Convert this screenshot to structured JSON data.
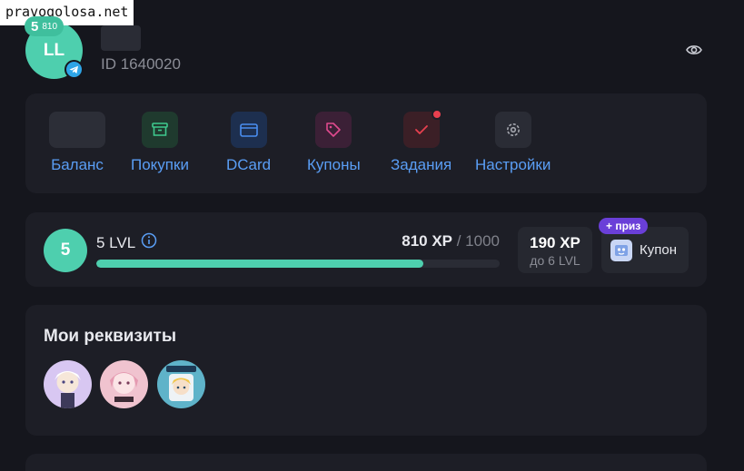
{
  "watermark": "pravogolosa.net",
  "profile": {
    "initials": "LL",
    "level": "5",
    "xp_badge": "810",
    "user_id": "ID 1640020"
  },
  "menu": {
    "items": [
      {
        "label": "Баланс",
        "icon": "balance-icon"
      },
      {
        "label": "Покупки",
        "icon": "archive-box-icon"
      },
      {
        "label": "DCard",
        "icon": "card-icon"
      },
      {
        "label": "Купоны",
        "icon": "tag-icon"
      },
      {
        "label": "Задания",
        "icon": "check-icon"
      },
      {
        "label": "Настройки",
        "icon": "gear-icon"
      }
    ]
  },
  "xp": {
    "level_number": "5",
    "level_label": "5 LVL",
    "current": "810 XP",
    "max": "/ 1000",
    "progress_fraction": 0.81,
    "next_xp": "190 XP",
    "next_level": "до 6 LVL",
    "prize_tag": "+ приз",
    "prize_label": "Купон"
  },
  "requisites": {
    "title": "Мои реквизиты"
  },
  "colors": {
    "accent_teal": "#4ecfae",
    "link_blue": "#5a9ef5",
    "prize_purple": "#6a3fd8",
    "notification_red": "#e8404f",
    "background": "#15161d",
    "card": "#1d1e26"
  }
}
